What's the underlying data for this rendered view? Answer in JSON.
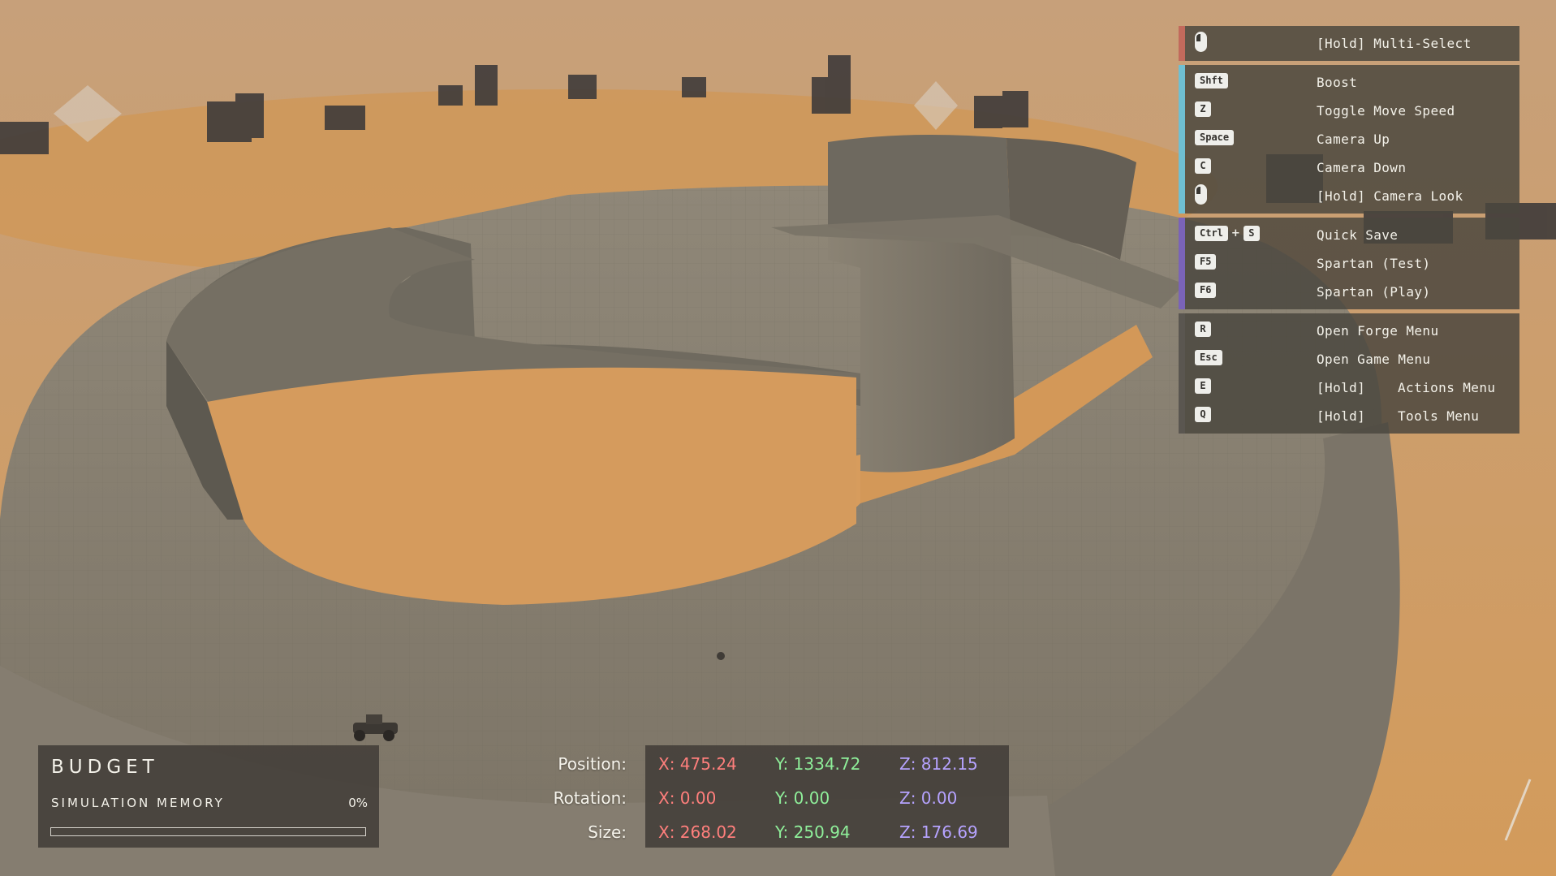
{
  "keybindings": {
    "groups": [
      {
        "accent": "#c26a5c",
        "items": [
          {
            "keys": [],
            "mouse": true,
            "label": "[Hold] Multi-Select",
            "label2": ""
          }
        ]
      },
      {
        "accent": "#6fbfd2",
        "items": [
          {
            "keys": [
              "Shft"
            ],
            "mouse": false,
            "label": "Boost",
            "label2": ""
          },
          {
            "keys": [
              "Z"
            ],
            "mouse": false,
            "label": "Toggle Move Speed",
            "label2": ""
          },
          {
            "keys": [
              "Space"
            ],
            "mouse": false,
            "label": "Camera Up",
            "label2": ""
          },
          {
            "keys": [
              "C"
            ],
            "mouse": false,
            "label": "Camera Down",
            "label2": ""
          },
          {
            "keys": [],
            "mouse": true,
            "label": "[Hold] Camera Look",
            "label2": ""
          }
        ]
      },
      {
        "accent": "#7a63b8",
        "items": [
          {
            "keys": [
              "Ctrl",
              "S"
            ],
            "mouse": false,
            "label": "Quick Save",
            "label2": ""
          },
          {
            "keys": [
              "F5"
            ],
            "mouse": false,
            "label": "Spartan (Test)",
            "label2": ""
          },
          {
            "keys": [
              "F6"
            ],
            "mouse": false,
            "label": "Spartan (Play)",
            "label2": ""
          }
        ]
      },
      {
        "accent": "#5a5650",
        "items": [
          {
            "keys": [
              "R"
            ],
            "mouse": false,
            "label": "Open Forge Menu",
            "label2": ""
          },
          {
            "keys": [
              "Esc"
            ],
            "mouse": false,
            "label": "Open Game Menu",
            "label2": ""
          },
          {
            "keys": [
              "E"
            ],
            "mouse": false,
            "label": "[Hold]",
            "label2": "Actions Menu"
          },
          {
            "keys": [
              "Q"
            ],
            "mouse": false,
            "label": "[Hold]",
            "label2": "Tools Menu"
          }
        ]
      }
    ]
  },
  "budget": {
    "title": "BUDGET",
    "subtitle": "SIMULATION MEMORY",
    "percent_text": "0%",
    "fill_fraction": 0.0
  },
  "transform": {
    "position_label": "Position:",
    "rotation_label": "Rotation:",
    "size_label": "Size:",
    "position": {
      "x": "X: 475.24",
      "y": "Y: 1334.72",
      "z": "Z: 812.15"
    },
    "rotation": {
      "x": "X: 0.00",
      "y": "Y: 0.00",
      "z": "Z: 0.00"
    },
    "size": {
      "x": "X: 268.02",
      "y": "Y: 250.94",
      "z": "Z: 176.69"
    }
  },
  "colors": {
    "x_axis": "#ff7f7c",
    "y_axis": "#8fef9a",
    "z_axis": "#b6a3ff"
  }
}
